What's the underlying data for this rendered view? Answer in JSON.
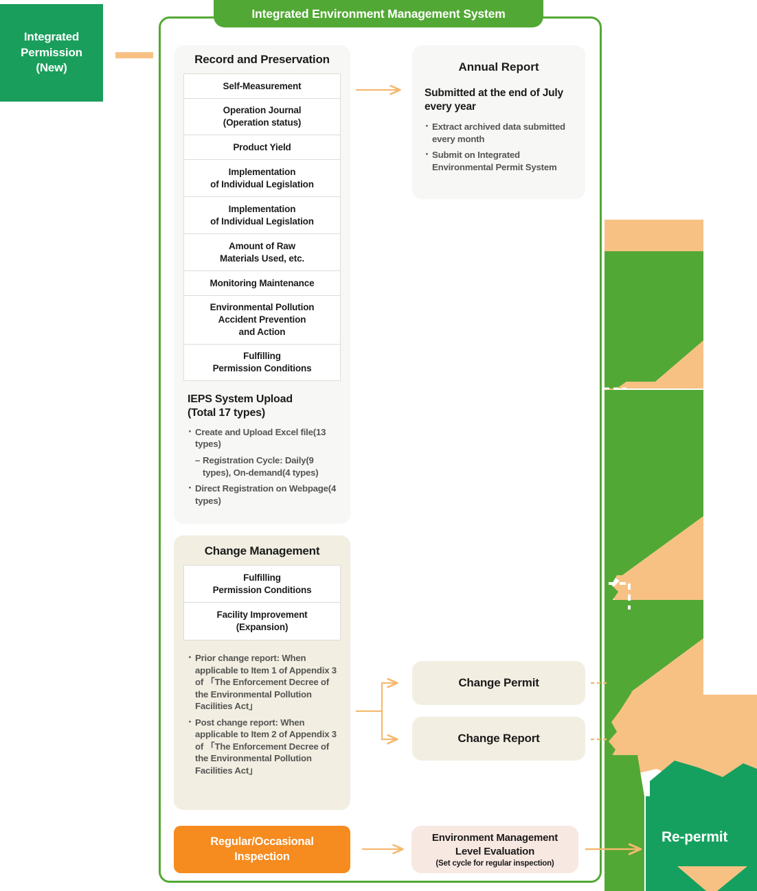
{
  "colors": {
    "frame_green": "#52a834",
    "entry_green": "#1a9e5c",
    "repermit_green": "#16a05f",
    "orange_accent": "#f7c184",
    "orange_solid": "#f68b1f",
    "panel_gray": "#f7f7f5",
    "panel_cream": "#f2eee2",
    "panel_pink": "#f8e8e2"
  },
  "entry": {
    "label": "Integrated\nPermission\n(New)",
    "line1": "Integrated",
    "line2": "Permission",
    "line3": "(New)"
  },
  "frame": {
    "title": "Integrated Environment Management System"
  },
  "record": {
    "title": "Record and Preservation",
    "items": [
      {
        "line1": "Self-Measurement",
        "line2": ""
      },
      {
        "line1": "Operation Journal",
        "line2": "(Operation status)"
      },
      {
        "line1": "Product Yield",
        "line2": ""
      },
      {
        "line1": "Implementation",
        "line2": "of Individual Legislation"
      },
      {
        "line1": "Implementation",
        "line2": "of Individual Legislation"
      },
      {
        "line1": "Amount of Raw",
        "line2": "Materials Used, etc."
      },
      {
        "line1": "Monitoring Maintenance",
        "line2": ""
      },
      {
        "line1": "Environmental Pollution",
        "line2": "Accident Prevention",
        "line3": "and Action"
      },
      {
        "line1": "Fulfilling",
        "line2": "Permission Conditions"
      }
    ]
  },
  "ieps": {
    "title_line1": "IEPS System Upload",
    "title_line2": "(Total 17 types)",
    "bullets": [
      {
        "type": "bullet",
        "text": "Create and Upload Excel file(13 types)"
      },
      {
        "type": "sub",
        "text": "Registration Cycle: Daily(9 types), On-demand(4 types)"
      },
      {
        "type": "bullet",
        "text": "Direct Registration on Webpage(4 types)"
      }
    ]
  },
  "annual_report": {
    "title": "Annual Report",
    "lead": "Submitted at the end of July every year",
    "bullets": [
      "Extract archived data submitted every month",
      "Submit on Integrated Environmental Permit System"
    ]
  },
  "change_management": {
    "title": "Change Management",
    "items": [
      {
        "line1": "Fulfilling",
        "line2": "Permission Conditions"
      },
      {
        "line1": "Facility Improvement",
        "line2": "(Expansion)"
      }
    ],
    "bullets": [
      "Prior change report: When applicable to Item 1 of Appendix 3 of 「The Enforcement Decree of the Environmental Pollution Facilities Act」",
      "Post change report: When applicable to Item 2 of Appendix 3 of 「The Enforcement Decree of the Environmental Pollution Facilities Act」"
    ]
  },
  "change_outputs": {
    "permit": "Change Permit",
    "report": "Change Report"
  },
  "inspection": {
    "line1": "Regular/Occasional",
    "line2": "Inspection"
  },
  "evaluation": {
    "line1": "Environment Management",
    "line2": "Level Evaluation",
    "note": "(Set cycle for regular inspection)"
  },
  "repermit": {
    "label": "Re-permit"
  }
}
